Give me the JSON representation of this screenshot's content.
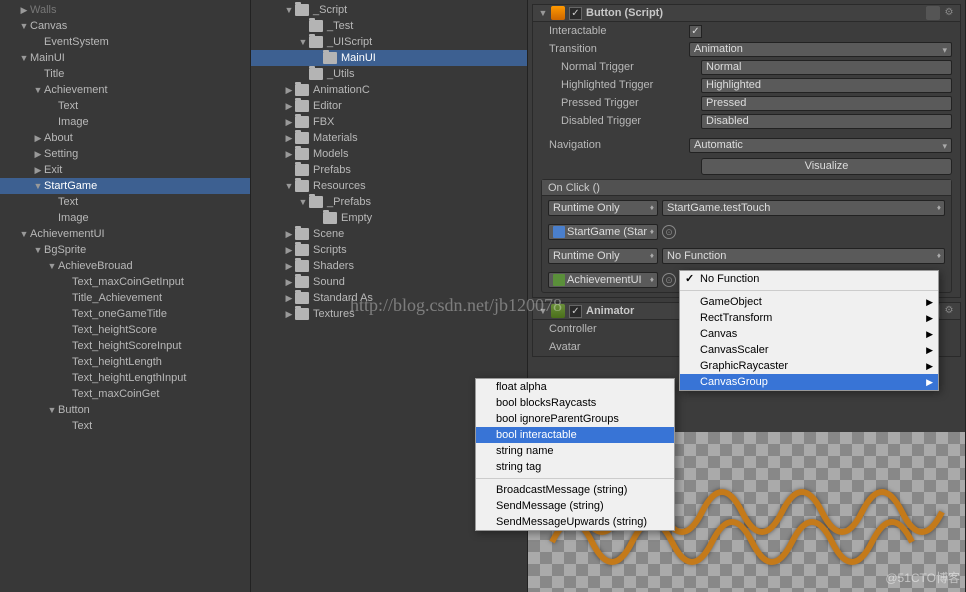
{
  "hierarchy": {
    "items": [
      {
        "label": "Walls",
        "depth": 1,
        "arrow": "right",
        "dim": true
      },
      {
        "label": "Canvas",
        "depth": 1,
        "arrow": "down"
      },
      {
        "label": "EventSystem",
        "depth": 2,
        "arrow": "empty"
      },
      {
        "label": "MainUI",
        "depth": 1,
        "arrow": "down"
      },
      {
        "label": "Title",
        "depth": 2,
        "arrow": "empty"
      },
      {
        "label": "Achievement",
        "depth": 2,
        "arrow": "down"
      },
      {
        "label": "Text",
        "depth": 3,
        "arrow": "empty"
      },
      {
        "label": "Image",
        "depth": 3,
        "arrow": "empty"
      },
      {
        "label": "About",
        "depth": 2,
        "arrow": "right"
      },
      {
        "label": "Setting",
        "depth": 2,
        "arrow": "right"
      },
      {
        "label": "Exit",
        "depth": 2,
        "arrow": "right"
      },
      {
        "label": "StartGame",
        "depth": 2,
        "arrow": "down",
        "selected": true
      },
      {
        "label": "Text",
        "depth": 3,
        "arrow": "empty"
      },
      {
        "label": "Image",
        "depth": 3,
        "arrow": "empty"
      },
      {
        "label": "AchievementUI",
        "depth": 1,
        "arrow": "down"
      },
      {
        "label": "BgSprite",
        "depth": 2,
        "arrow": "down"
      },
      {
        "label": "AchieveBrouad",
        "depth": 3,
        "arrow": "down"
      },
      {
        "label": "Text_maxCoinGetInput",
        "depth": 4,
        "arrow": "empty"
      },
      {
        "label": "Title_Achievement",
        "depth": 4,
        "arrow": "empty"
      },
      {
        "label": "Text_oneGameTitle",
        "depth": 4,
        "arrow": "empty"
      },
      {
        "label": "Text_heightScore",
        "depth": 4,
        "arrow": "empty"
      },
      {
        "label": "Text_heightScoreInput",
        "depth": 4,
        "arrow": "empty"
      },
      {
        "label": "Text_heightLength",
        "depth": 4,
        "arrow": "empty"
      },
      {
        "label": "Text_heightLengthInput",
        "depth": 4,
        "arrow": "empty"
      },
      {
        "label": "Text_maxCoinGet",
        "depth": 4,
        "arrow": "empty"
      },
      {
        "label": "Button",
        "depth": 3,
        "arrow": "down"
      },
      {
        "label": "Text",
        "depth": 4,
        "arrow": "empty"
      }
    ]
  },
  "project": {
    "items": [
      {
        "label": "_Script",
        "depth": 2,
        "arrow": "down"
      },
      {
        "label": "_Test",
        "depth": 3,
        "arrow": "empty"
      },
      {
        "label": "_UIScript",
        "depth": 3,
        "arrow": "down"
      },
      {
        "label": "MainUI",
        "depth": 4,
        "arrow": "empty",
        "selected": true
      },
      {
        "label": "_Utils",
        "depth": 3,
        "arrow": "empty"
      },
      {
        "label": "AnimationC",
        "depth": 2,
        "arrow": "right"
      },
      {
        "label": "Editor",
        "depth": 2,
        "arrow": "right"
      },
      {
        "label": "FBX",
        "depth": 2,
        "arrow": "right"
      },
      {
        "label": "Materials",
        "depth": 2,
        "arrow": "right"
      },
      {
        "label": "Models",
        "depth": 2,
        "arrow": "right"
      },
      {
        "label": "Prefabs",
        "depth": 2,
        "arrow": "empty"
      },
      {
        "label": "Resources",
        "depth": 2,
        "arrow": "down"
      },
      {
        "label": "_Prefabs",
        "depth": 3,
        "arrow": "down"
      },
      {
        "label": "Empty",
        "depth": 4,
        "arrow": "empty"
      },
      {
        "label": "Scene",
        "depth": 2,
        "arrow": "right"
      },
      {
        "label": "Scripts",
        "depth": 2,
        "arrow": "right"
      },
      {
        "label": "Shaders",
        "depth": 2,
        "arrow": "right"
      },
      {
        "label": "Sound",
        "depth": 2,
        "arrow": "right"
      },
      {
        "label": "Standard As",
        "depth": 2,
        "arrow": "right"
      },
      {
        "label": "Textures",
        "depth": 2,
        "arrow": "right"
      }
    ]
  },
  "inspector": {
    "button_comp": {
      "title": "Button (Script)",
      "interactable_label": "Interactable",
      "transition_label": "Transition",
      "transition_value": "Animation",
      "normal_trigger_label": "Normal Trigger",
      "normal_trigger_value": "Normal",
      "highlighted_trigger_label": "Highlighted Trigger",
      "highlighted_trigger_value": "Highlighted",
      "pressed_trigger_label": "Pressed Trigger",
      "pressed_trigger_value": "Pressed",
      "disabled_trigger_label": "Disabled Trigger",
      "disabled_trigger_value": "Disabled",
      "navigation_label": "Navigation",
      "navigation_value": "Automatic",
      "visualize_label": "Visualize",
      "onclick_label": "On Click ()",
      "events": [
        {
          "runtime": "Runtime Only",
          "target": "StartGame (Star",
          "func": "StartGame.testTouch",
          "icon": "blue"
        },
        {
          "runtime": "Runtime Only",
          "target": "AchievementUI",
          "func": "No Function",
          "icon": "green"
        }
      ]
    },
    "animator_comp": {
      "title": "Animator",
      "controller_label": "Controller",
      "avatar_label": "Avatar"
    }
  },
  "popup_props": {
    "items": [
      "float alpha",
      "bool blocksRaycasts",
      "bool ignoreParentGroups",
      "bool interactable",
      "string name",
      "string tag",
      "BroadcastMessage (string)",
      "SendMessage (string)",
      "SendMessageUpwards (string)"
    ],
    "selected": 3
  },
  "popup_funcs": {
    "items": [
      {
        "label": "No Function",
        "checked": true
      },
      {
        "sep": true
      },
      {
        "label": "GameObject",
        "sub": true
      },
      {
        "label": "RectTransform",
        "sub": true
      },
      {
        "label": "Canvas",
        "sub": true
      },
      {
        "label": "CanvasScaler",
        "sub": true
      },
      {
        "label": "GraphicRaycaster",
        "sub": true
      },
      {
        "label": "CanvasGroup",
        "sub": true,
        "selected": true
      }
    ]
  },
  "watermark": "http://blog.csdn.net/jb120078",
  "brand": "@51CTO博客"
}
